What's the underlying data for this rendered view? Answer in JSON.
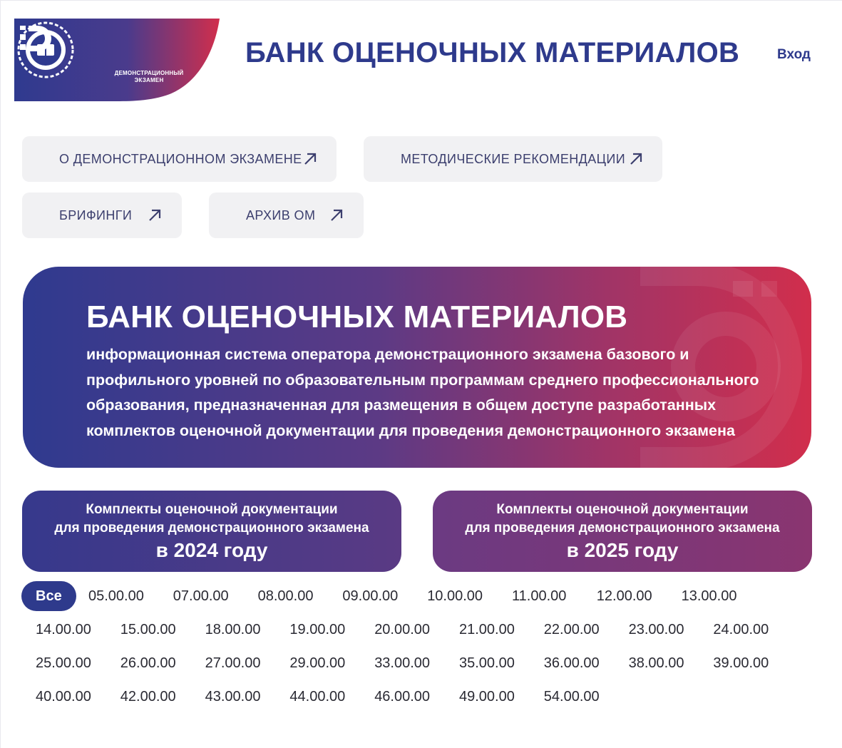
{
  "header": {
    "logo_caption_line1": "ДЕМОНСТРАЦИОННЫЙ",
    "logo_caption_line2": "ЭКЗАМЕН",
    "title": "БАНК ОЦЕНОЧНЫХ МАТЕРИАЛОВ",
    "login": "Вход"
  },
  "nav": {
    "items": [
      {
        "label": "О ДЕМОНСТРАЦИОННОМ ЭКЗАМЕНЕ"
      },
      {
        "label": "МЕТОДИЧЕСКИЕ РЕКОМЕНДАЦИИ"
      },
      {
        "label": "БРИФИНГИ"
      },
      {
        "label": "АРХИВ ОМ"
      }
    ],
    "icon": "arrow-up-right-icon"
  },
  "hero": {
    "title": "БАНК ОЦЕНОЧНЫХ МАТЕРИАЛОВ",
    "description": "информационная система оператора демонстрационного экзамена базового и профильного уровней по образовательным программам среднего профессионального образования, предназначенная для размещения в общем доступе разработанных комплектов оценочной документации для проведения демонстрационного экзамена"
  },
  "kits": [
    {
      "line1": "Комплекты оценочной документации",
      "line2": "для проведения демонстрационного экзамена",
      "year": "в 2024 году"
    },
    {
      "line1": "Комплекты оценочной документации",
      "line2": "для проведения демонстрационного экзамена",
      "year": "в 2025 году"
    }
  ],
  "filters": {
    "active": "Все",
    "codes": [
      "Все",
      "05.00.00",
      "07.00.00",
      "08.00.00",
      "09.00.00",
      "10.00.00",
      "11.00.00",
      "12.00.00",
      "13.00.00",
      "14.00.00",
      "15.00.00",
      "18.00.00",
      "19.00.00",
      "20.00.00",
      "21.00.00",
      "22.00.00",
      "23.00.00",
      "24.00.00",
      "25.00.00",
      "26.00.00",
      "27.00.00",
      "29.00.00",
      "33.00.00",
      "35.00.00",
      "36.00.00",
      "38.00.00",
      "39.00.00",
      "40.00.00",
      "42.00.00",
      "43.00.00",
      "44.00.00",
      "46.00.00",
      "49.00.00",
      "54.00.00"
    ]
  },
  "colors": {
    "brand_blue": "#2e3a8c",
    "brand_red": "#d12e4c",
    "nav_bg": "#f1f1f3"
  }
}
